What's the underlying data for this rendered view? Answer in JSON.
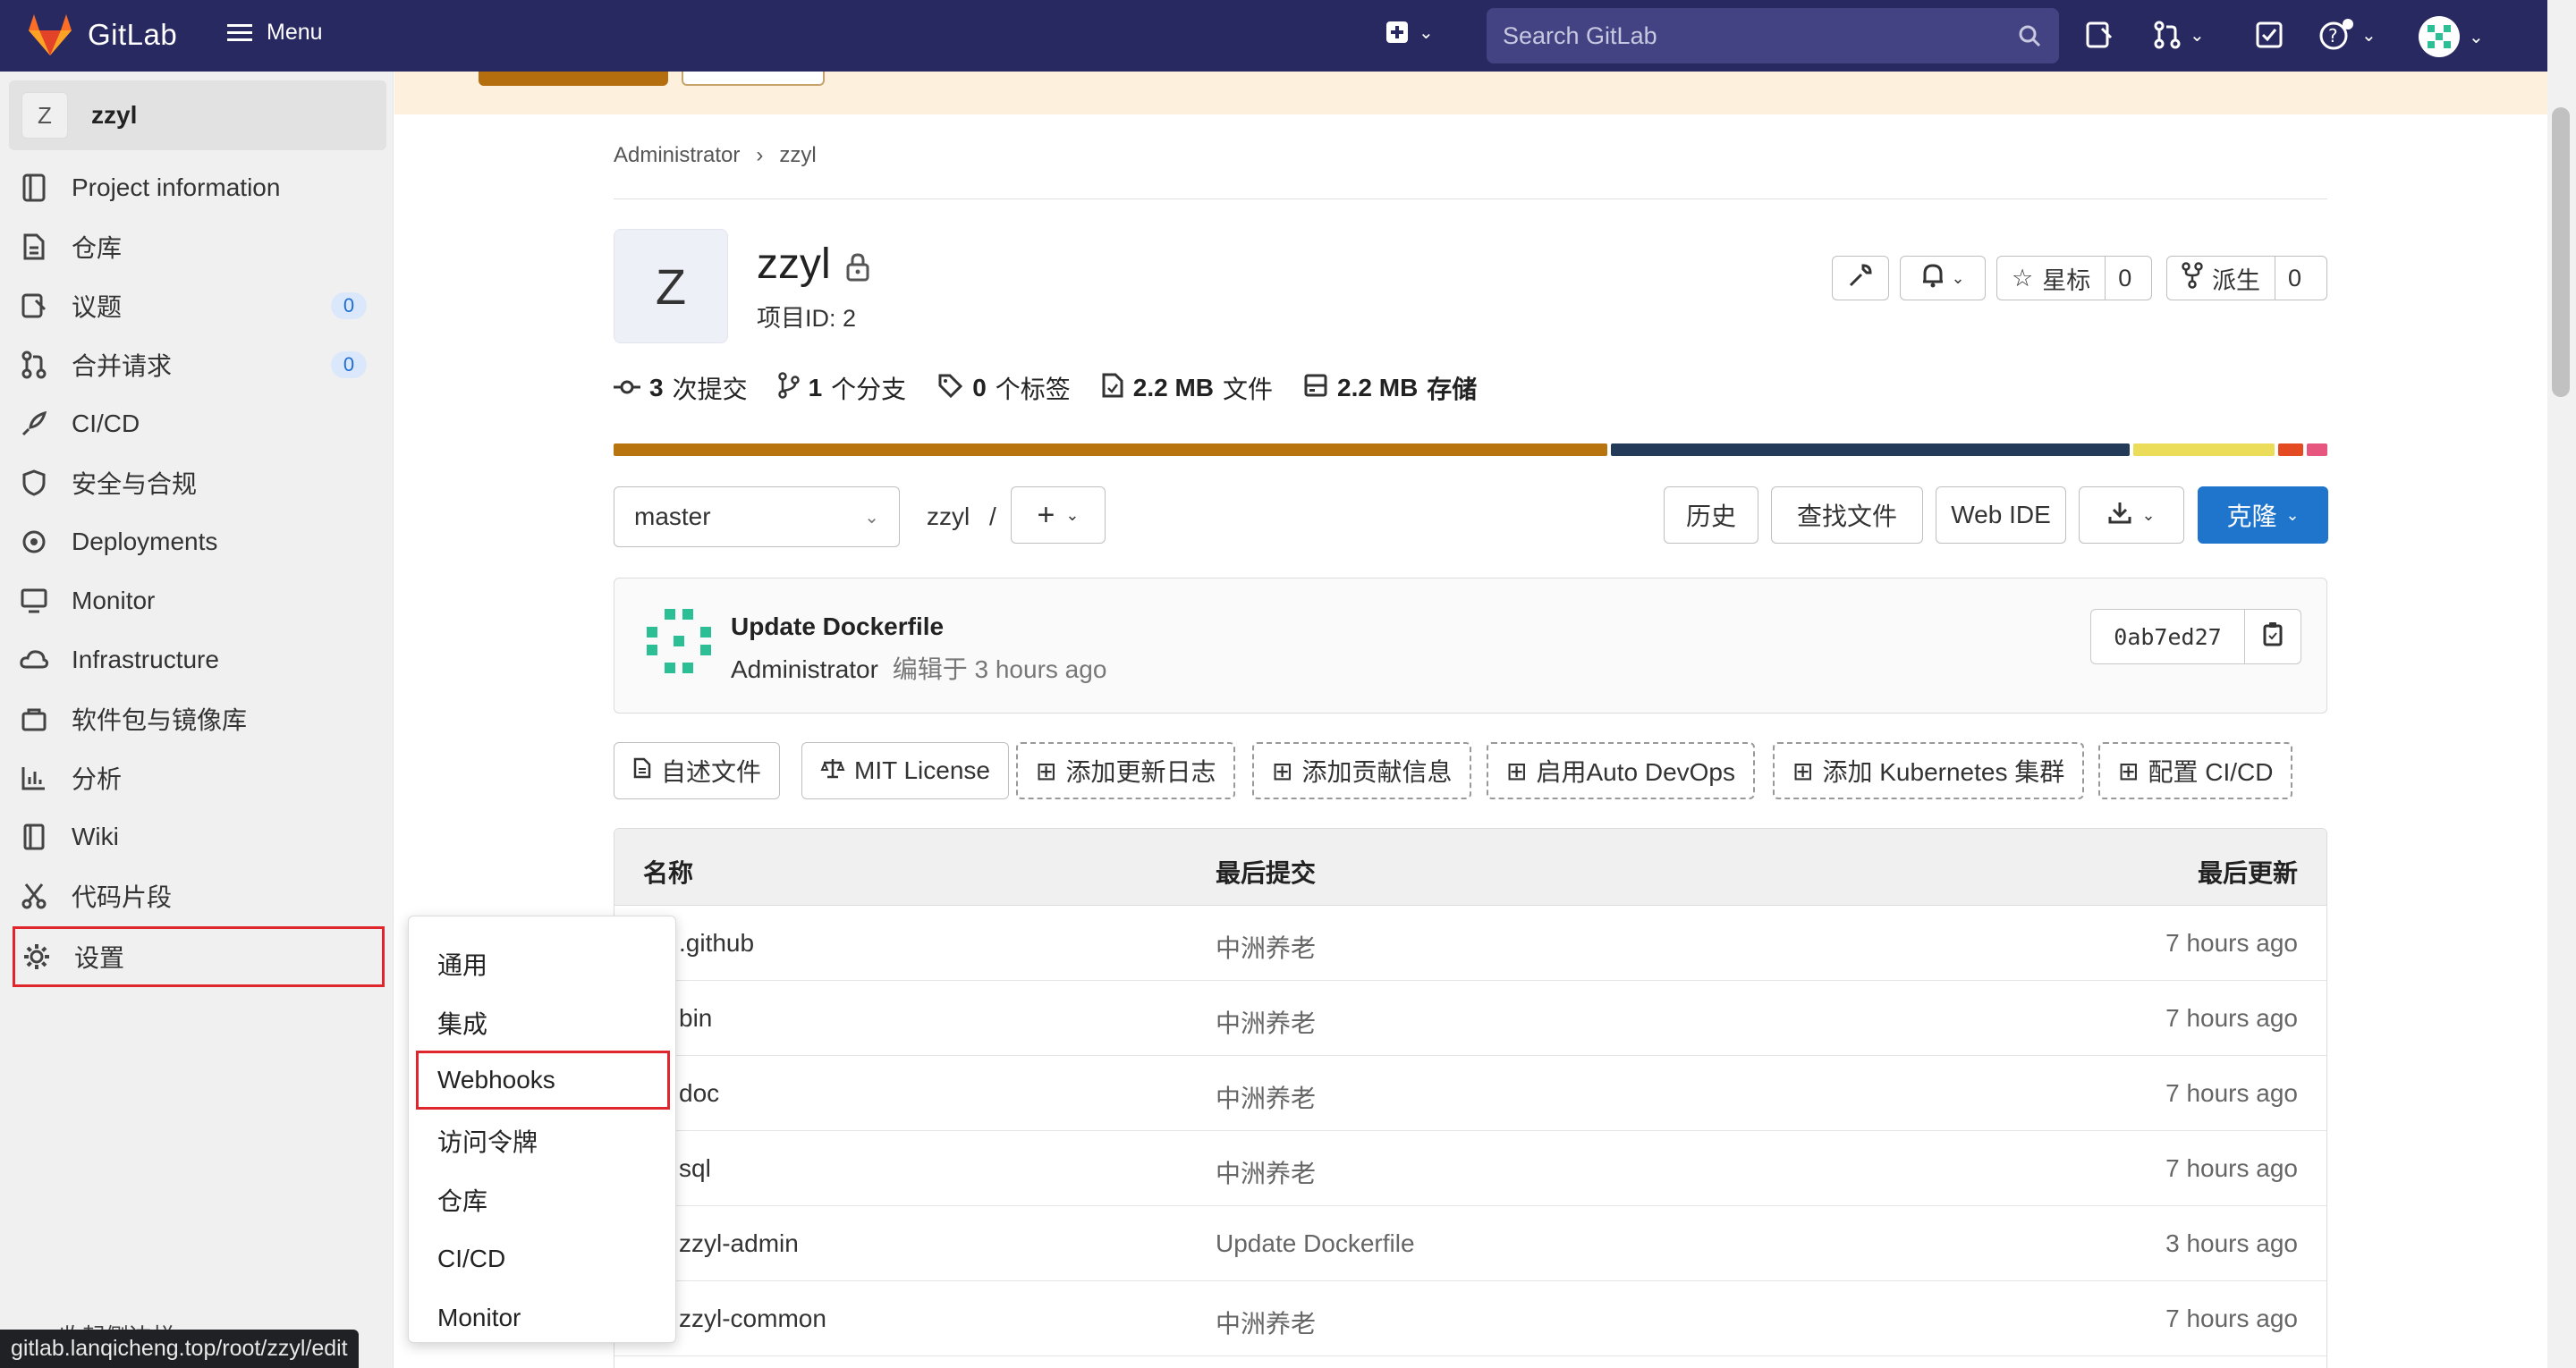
{
  "topbar": {
    "logo_text": "GitLab",
    "menu_label": "Menu",
    "search_placeholder": "Search GitLab"
  },
  "sidebar": {
    "project_initial": "Z",
    "project_name": "zzyl",
    "items": [
      {
        "label": "Project information",
        "icon": "info-icon"
      },
      {
        "label": "仓库",
        "icon": "repository-icon"
      },
      {
        "label": "议题",
        "icon": "issues-icon",
        "badge": "0"
      },
      {
        "label": "合并请求",
        "icon": "merge-request-icon",
        "badge": "0"
      },
      {
        "label": "CI/CD",
        "icon": "rocket-icon"
      },
      {
        "label": "安全与合规",
        "icon": "shield-icon"
      },
      {
        "label": "Deployments",
        "icon": "deployments-icon"
      },
      {
        "label": "Monitor",
        "icon": "monitor-icon"
      },
      {
        "label": "Infrastructure",
        "icon": "cloud-icon"
      },
      {
        "label": "软件包与镜像库",
        "icon": "package-icon"
      },
      {
        "label": "分析",
        "icon": "chart-icon"
      },
      {
        "label": "Wiki",
        "icon": "book-icon"
      },
      {
        "label": "代码片段",
        "icon": "scissors-icon"
      },
      {
        "label": "设置",
        "icon": "gear-icon"
      }
    ],
    "collapse_label": "收起侧边栏"
  },
  "status_url": "gitlab.lanqicheng.top/root/zzyl/edit",
  "breadcrumb": [
    "Administrator",
    "zzyl"
  ],
  "project": {
    "initial": "Z",
    "name": "zzyl",
    "id_label": "项目ID: 2",
    "star_label": "星标",
    "star_count": "0",
    "fork_label": "派生",
    "fork_count": "0"
  },
  "stats": [
    {
      "icon": "commit-icon",
      "value": "3",
      "label": "次提交"
    },
    {
      "icon": "branch-icon",
      "value": "1",
      "label": "个分支"
    },
    {
      "icon": "tag-icon",
      "value": "0",
      "label": "个标签"
    },
    {
      "icon": "file-icon",
      "value": "2.2 MB",
      "label": "文件"
    },
    {
      "icon": "storage-icon",
      "value": "2.2 MB",
      "label": "存储"
    }
  ],
  "languages": [
    {
      "color": "#b8740f",
      "fraction": 0.585
    },
    {
      "color": "#233a59",
      "fraction": 0.305
    },
    {
      "color": "#ebdc5a",
      "fraction": 0.083
    },
    {
      "color": "#e44b23",
      "fraction": 0.015
    },
    {
      "color": "#e6567e",
      "fraction": 0.012
    }
  ],
  "toolbar": {
    "branch": "master",
    "path": "zzyl",
    "path_sep": "/",
    "history": "历史",
    "find_file": "查找文件",
    "web_ide": "Web IDE",
    "clone": "克隆"
  },
  "commit": {
    "title": "Update Dockerfile",
    "author": "Administrator",
    "meta": "编辑于 3 hours ago",
    "sha": "0ab7ed27"
  },
  "chips": [
    {
      "label": "自述文件",
      "style": "solid",
      "icon": "file-icon"
    },
    {
      "label": "MIT License",
      "style": "solid",
      "icon": "scale-icon"
    },
    {
      "label": "添加更新日志",
      "style": "dashed",
      "icon": "plus-square-icon"
    },
    {
      "label": "添加贡献信息",
      "style": "dashed",
      "icon": "plus-square-icon"
    },
    {
      "label": "启用Auto DevOps",
      "style": "dashed",
      "icon": "plus-square-icon"
    },
    {
      "label": "添加 Kubernetes 集群",
      "style": "dashed",
      "icon": "plus-square-icon"
    },
    {
      "label": "配置 CI/CD",
      "style": "dashed",
      "icon": "plus-square-icon"
    }
  ],
  "table": {
    "headers": [
      "名称",
      "最后提交",
      "最后更新"
    ],
    "rows": [
      {
        "name": ".github",
        "commit": "中洲养老",
        "updated": "7 hours ago"
      },
      {
        "name": "bin",
        "commit": "中洲养老",
        "updated": "7 hours ago"
      },
      {
        "name": "doc",
        "commit": "中洲养老",
        "updated": "7 hours ago"
      },
      {
        "name": "sql",
        "commit": "中洲养老",
        "updated": "7 hours ago"
      },
      {
        "name": "zzyl-admin",
        "commit": "Update Dockerfile",
        "updated": "3 hours ago"
      },
      {
        "name": "zzyl-common",
        "commit": "中洲养老",
        "updated": "7 hours ago"
      }
    ]
  },
  "settings_menu": [
    "通用",
    "集成",
    "Webhooks",
    "访问令牌",
    "仓库",
    "CI/CD",
    "Monitor"
  ]
}
